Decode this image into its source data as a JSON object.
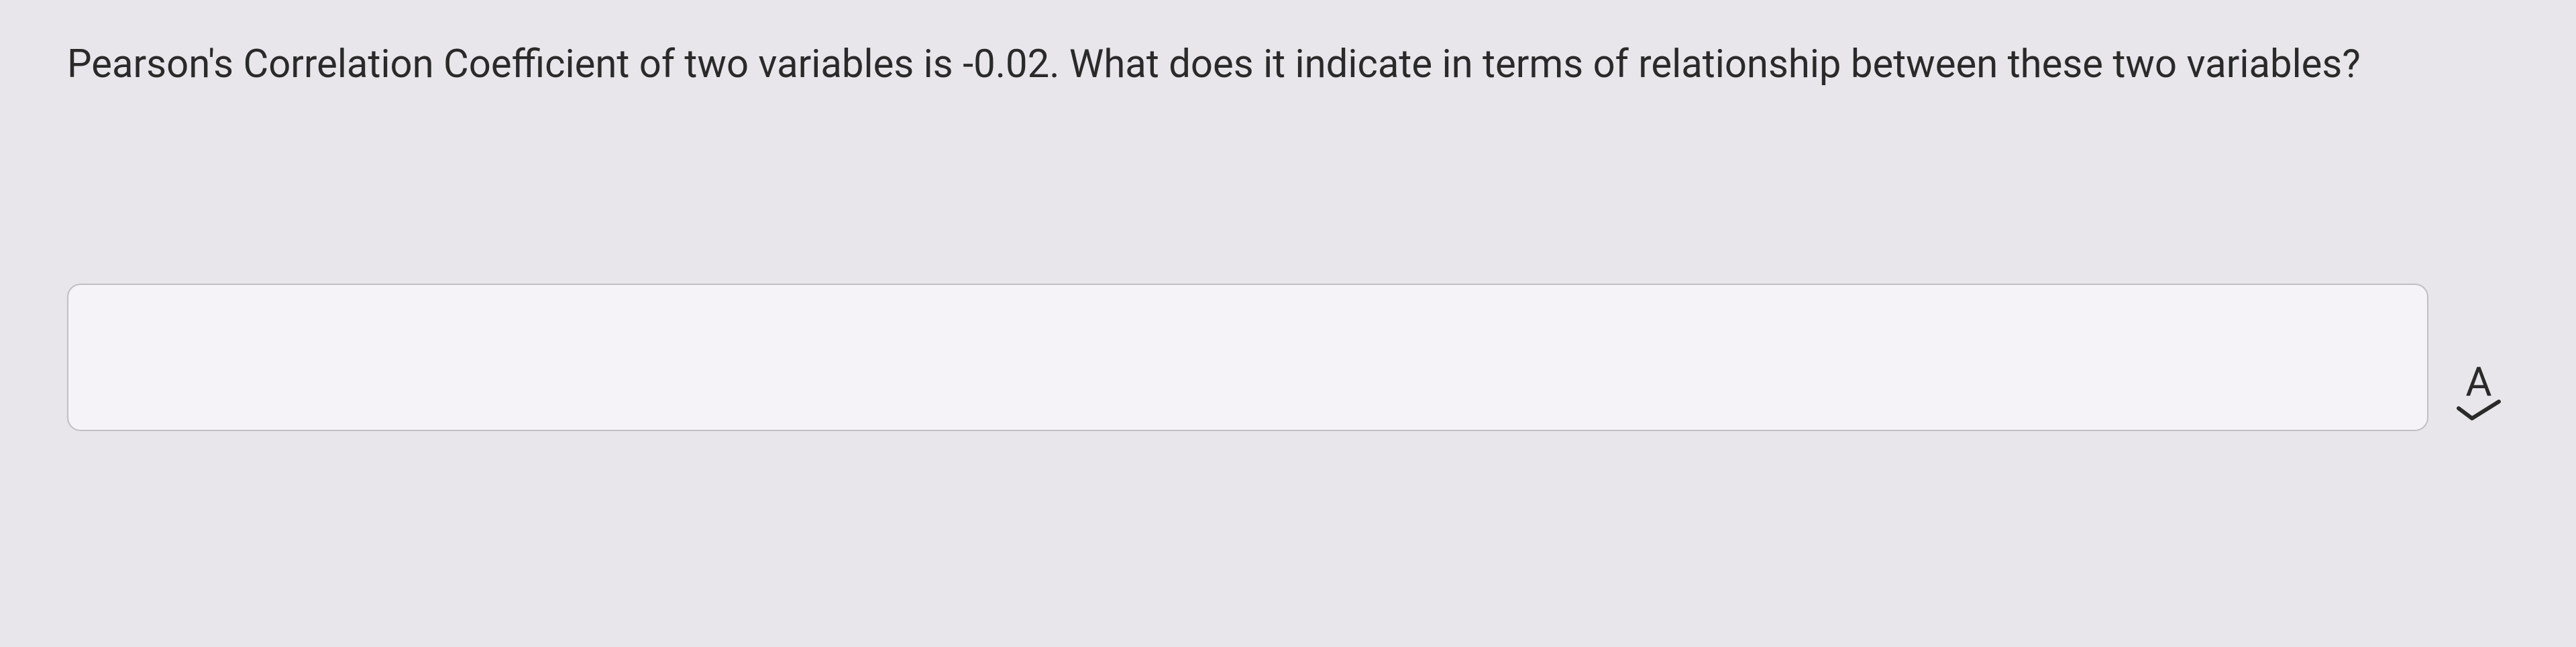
{
  "question": {
    "text": "Pearson's Correlation Coefficient of two variables is -0.02. What does it indicate in terms of relationship between these two variables?"
  },
  "answer": {
    "value": "",
    "placeholder": ""
  },
  "icons": {
    "spellcheck_letter": "A"
  }
}
